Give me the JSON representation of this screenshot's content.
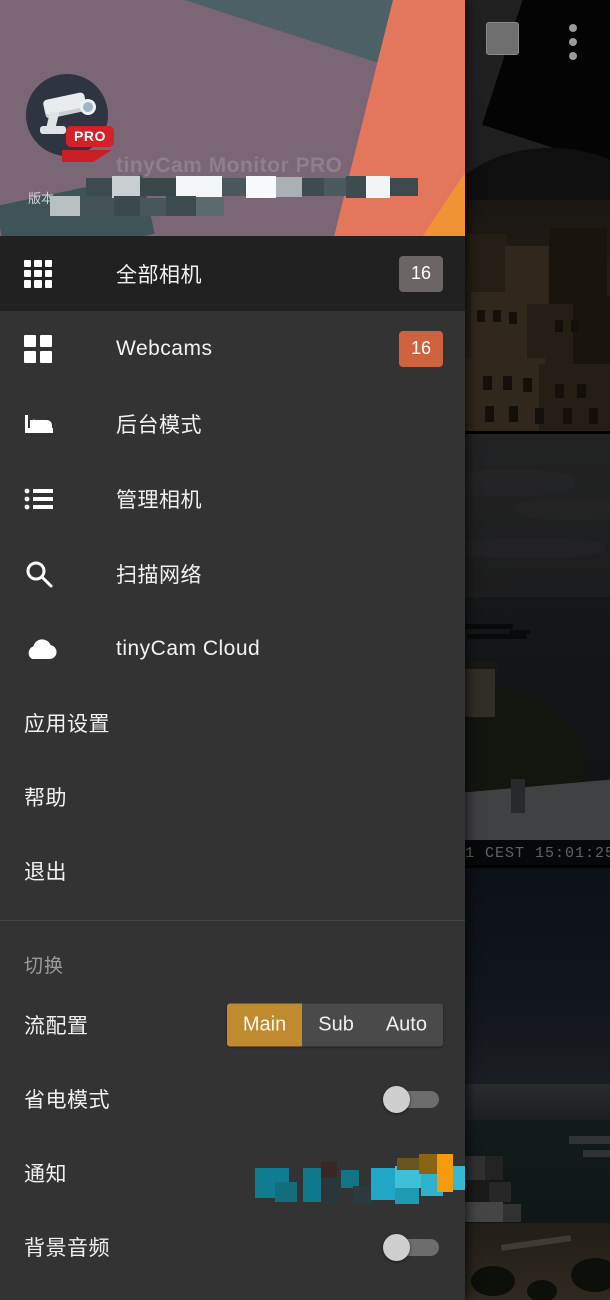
{
  "app": {
    "logo_badge": "PRO",
    "title_partial": "tinyCam Monitor PRO",
    "version_label": "版本"
  },
  "camera_grid": {
    "overflow_icon": "more-vertical-icon",
    "panels": [
      {
        "name": "town-mountain-camera",
        "timestamp": ""
      },
      {
        "name": "coast-sea-camera",
        "timestamp": "1  CEST  15:01:25"
      },
      {
        "name": "marina-harbor-camera",
        "timestamp": ""
      }
    ]
  },
  "menu": {
    "items": [
      {
        "label": "全部相机",
        "icon": "grid-9-icon",
        "badge": "16",
        "badge_color": "#6c6565",
        "selected": true
      },
      {
        "label": "Webcams",
        "icon": "grid-4-icon",
        "badge": "16",
        "badge_color": "#cf6340",
        "selected": false
      },
      {
        "label": "后台模式",
        "icon": "bed-icon",
        "badge": "",
        "selected": false
      },
      {
        "label": "管理相机",
        "icon": "list-icon",
        "badge": "",
        "selected": false
      },
      {
        "label": "扫描网络",
        "icon": "search-icon",
        "badge": "",
        "selected": false
      },
      {
        "label": "tinyCam Cloud",
        "icon": "cloud-icon",
        "badge": "",
        "selected": false
      }
    ],
    "plain_items": [
      {
        "label": "应用设置"
      },
      {
        "label": "帮助"
      },
      {
        "label": "退出"
      }
    ]
  },
  "switches_section": {
    "title": "切换",
    "stream_profile": {
      "label": "流配置",
      "options": [
        "Main",
        "Sub",
        "Auto"
      ],
      "selected": "Main",
      "selected_color": "#c08a2e"
    },
    "rows": [
      {
        "label": "省电模式",
        "control": "toggle",
        "state": "off"
      },
      {
        "label": "通知",
        "control": "redacted",
        "state": ""
      },
      {
        "label": "背景音频",
        "control": "toggle",
        "state": "off"
      }
    ]
  }
}
